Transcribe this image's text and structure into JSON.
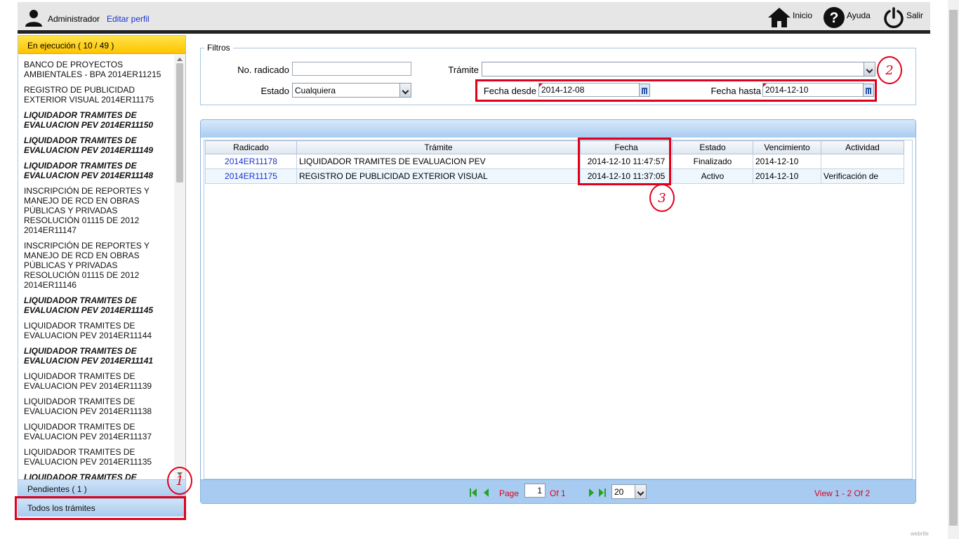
{
  "header": {
    "user_name": "Administrador",
    "edit_profile": "Editar perfil",
    "nav": [
      {
        "label": "Inicio",
        "icon": "home-icon"
      },
      {
        "label": "Ayuda",
        "icon": "help-icon"
      },
      {
        "label": "Salir",
        "icon": "power-icon"
      }
    ]
  },
  "sidebar": {
    "active_section": "En ejecución ( 10 / 49 )",
    "items": [
      {
        "text": "BANCO DE PROYECTOS AMBIENTALES - BPA 2014ER11215",
        "bold": false
      },
      {
        "text": "REGISTRO DE PUBLICIDAD EXTERIOR VISUAL 2014ER11175",
        "bold": false
      },
      {
        "text": "LIQUIDADOR TRAMITES DE EVALUACION PEV 2014ER11150",
        "bold": true
      },
      {
        "text": "LIQUIDADOR TRAMITES DE EVALUACION PEV 2014ER11149",
        "bold": true
      },
      {
        "text": "LIQUIDADOR TRAMITES DE EVALUACION PEV 2014ER11148",
        "bold": true
      },
      {
        "text": "INSCRIPCIÓN DE REPORTES Y MANEJO DE RCD EN OBRAS PÚBLICAS Y PRIVADAS RESOLUCIÓN 01115 DE 2012 2014ER11147",
        "bold": false
      },
      {
        "text": "INSCRIPCIÓN DE REPORTES Y MANEJO DE RCD EN OBRAS PÚBLICAS Y PRIVADAS RESOLUCIÓN 01115 DE 2012 2014ER11146",
        "bold": false
      },
      {
        "text": "LIQUIDADOR TRAMITES DE EVALUACION PEV 2014ER11145",
        "bold": true
      },
      {
        "text": "LIQUIDADOR TRAMITES DE EVALUACION PEV 2014ER11144",
        "bold": false
      },
      {
        "text": "LIQUIDADOR TRAMITES DE EVALUACION PEV 2014ER11141",
        "bold": true
      },
      {
        "text": "LIQUIDADOR TRAMITES DE EVALUACION PEV 2014ER11139",
        "bold": false
      },
      {
        "text": "LIQUIDADOR TRAMITES DE EVALUACION PEV 2014ER11138",
        "bold": false
      },
      {
        "text": "LIQUIDADOR TRAMITES DE EVALUACION PEV 2014ER11137",
        "bold": false
      },
      {
        "text": "LIQUIDADOR TRAMITES DE EVALUACION PEV 2014ER11135",
        "bold": false
      },
      {
        "text": "LIQUIDADOR TRAMITES DE",
        "bold": true
      }
    ],
    "pending": "Pendientes ( 1 )",
    "all": "Todos los trámites"
  },
  "filters": {
    "legend": "Filtros",
    "radicado_label": "No. radicado",
    "radicado_value": "",
    "tramite_label": "Trámite",
    "tramite_value": "",
    "estado_label": "Estado",
    "estado_value": "Cualquiera",
    "fecha_desde_label": "Fecha desde",
    "fecha_desde_value": "2014-12-08",
    "fecha_hasta_label": "Fecha hasta",
    "fecha_hasta_value": "2014-12-10"
  },
  "table": {
    "headers": [
      "Radicado",
      "Trámite",
      "Fecha",
      "Estado",
      "Vencimiento",
      "Actividad"
    ],
    "rows": [
      [
        "2014ER11178",
        "LIQUIDADOR TRAMITES DE EVALUACION PEV",
        "2014-12-10 11:47:57",
        "Finalizado",
        "2014-12-10",
        ""
      ],
      [
        "2014ER11175",
        "REGISTRO DE PUBLICIDAD EXTERIOR VISUAL",
        "2014-12-10 11:37:05",
        "Activo",
        "2014-12-10",
        "Verificación de"
      ]
    ]
  },
  "pager": {
    "page_label": "Page",
    "page_value": "1",
    "of_label": "Of 1",
    "page_size": "20",
    "view_label": "View 1 - 2 Of 2"
  },
  "annotations": [
    "1",
    "2",
    "3"
  ],
  "watermark": "webrtle"
}
